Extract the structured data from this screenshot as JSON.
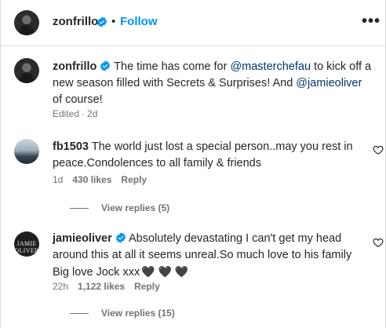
{
  "header": {
    "username": "zonfrillo",
    "separator": "•",
    "follow_label": "Follow",
    "more_label": "•••"
  },
  "caption": {
    "username": "zonfrillo",
    "text_1": " The time has come for ",
    "mention_1": "@masterchefau",
    "text_2": " to kick off a new season filled with Secrets & Surprises! And ",
    "mention_2": "@jamieoliver",
    "text_3": " of course!",
    "edited": "Edited",
    "dot": "·",
    "time": "2d"
  },
  "comments": [
    {
      "username": "fb1503",
      "text": " The world just lost a special person..may you rest in peace.Condolences to all family & friends",
      "time": "1d",
      "likes": "430 likes",
      "reply_label": "Reply",
      "view_replies": "View replies (5)"
    },
    {
      "username": "jamieoliver",
      "avatar_text": "JAMIE OLIVER",
      "text": " Absolutely devastating I can't get my head around this at all it seems unreal.So much love to his family Big love Jock xxx",
      "hearts": "🖤 🖤 🖤",
      "time": "22h",
      "likes": "1,122 likes",
      "reply_label": "Reply",
      "view_replies": "View replies (15)"
    }
  ],
  "icons": {
    "verified": "verified-badge-icon",
    "like": "heart-outline-icon",
    "more": "more-options-icon"
  },
  "colors": {
    "accent": "#0095f6",
    "mention": "#00376b",
    "verified": "#0095f6",
    "muted": "#737373",
    "text": "#262626"
  }
}
